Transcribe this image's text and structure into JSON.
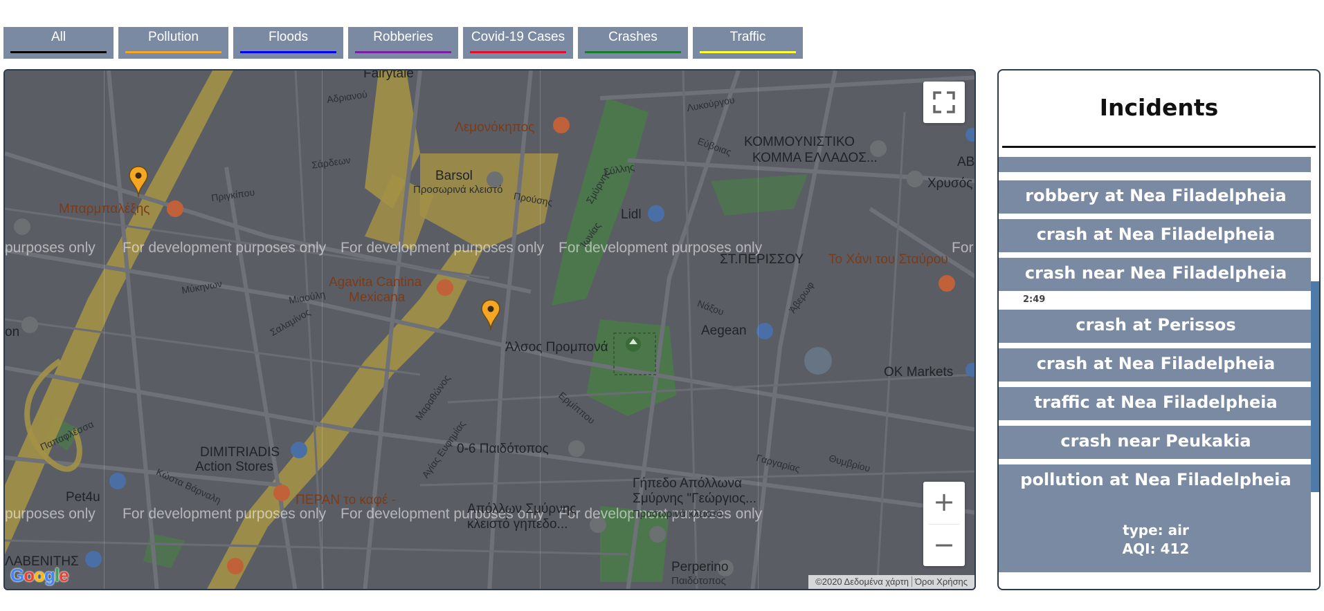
{
  "filters": [
    {
      "label": "All",
      "color": "#000000"
    },
    {
      "label": "Pollution",
      "color": "#f5a623"
    },
    {
      "label": "Floods",
      "color": "#0000ff"
    },
    {
      "label": "Robberies",
      "color": "#7b1fa2"
    },
    {
      "label": "Covid-19 Cases",
      "color": "#e0102a"
    },
    {
      "label": "Crashes",
      "color": "#1b7a2b"
    },
    {
      "label": "Traffic",
      "color": "#ffff33"
    }
  ],
  "map": {
    "watermark": "For development purposes only",
    "watermark_partial": "purposes only",
    "watermark_edge": "For",
    "pois": {
      "fairytale": "Fairytale",
      "lemonokipos": "Λεμονόκηπος",
      "barsol": "Barsol",
      "barsol_sub": "Προσωρινά κλειστό",
      "lidl": "Lidl",
      "kke_1": "ΚΟΜΜΟΥΝΙΣΤΙΚΟ",
      "kke_2": "ΚΟΜΜΑ ΕΛΛΑΔΟΣ...",
      "chrysos": "Χρυσός",
      "ab": "ΑΒ",
      "barbalexis": "Μπαρμπαλέξης",
      "agavita_1": "Agavita Cantina",
      "agavita_2": "Mexicana",
      "st_perissou": "ΣΤ.ΠΕΡΙΣΣΟΥ",
      "to_chani": "Το Χάνι του Σταύρου",
      "aegean": "Aegean",
      "alsos": "Άλσος Προμπονά",
      "ok_markets": "OK Markets",
      "dimitriadis_1": "DIMITRIADIS",
      "dimitriadis_2": "Action Stores",
      "paidotopos": "0-6 Παιδότοπος",
      "gipedo_1": "Γήπεδο Απόλλωνα",
      "gipedo_2": "Σμύρνης \"Γεώργιος...",
      "gipedo_3": "Προσωρινά κλειστό",
      "pet4u": "Pet4u",
      "peran": "ΠΕΡΑΝ το καφέ -",
      "apollon_1": "Απόλλων Σμύρνης",
      "apollon_2": "κλειστό γηπεδο...",
      "lavenitis": "ΛΑΒΕΝΙΤΗΣ",
      "perperino_1": "Perperino",
      "perperino_2": "Παιδότοπος",
      "on": "on"
    },
    "streets": {
      "s1": "Σάρδεων",
      "s2": "Πριγκίπου",
      "s3": "Αδριανού",
      "s4": "Λυκούργου",
      "s5": "Εύβοιας",
      "s6": "Σύλλης",
      "s7": "Προύσης",
      "s8": "Μιαούλη",
      "s9": "Σαλαμίνος",
      "s10": "Μύκηνων",
      "s11": "Νάξου",
      "s12": "Άβερωφ",
      "s13": "Μαραθώνος",
      "s14": "Αγίας Ευφημίας",
      "s15": "Ερμίππου",
      "s16": "Κώστα Βάρναλη",
      "s17": "Παπαφλέσσα",
      "s18": "Σμύρνης",
      "s19": "Ίωνίας",
      "s20": "Γαργαρίας",
      "s21": "Θυμβρίου"
    },
    "fullscreen_icon": "fullscreen-icon",
    "zoom_in": "+",
    "zoom_out": "−",
    "attribution": {
      "data": "©2020 Δεδομένα χάρτη",
      "terms": "Όροι Χρήσης"
    },
    "google_logo": {
      "text": "Google",
      "colors": [
        "#4285F4",
        "#EA4335",
        "#FBBC05",
        "#4285F4",
        "#34A853",
        "#EA4335"
      ]
    }
  },
  "panel": {
    "title": "Incidents",
    "incidents": [
      {
        "title": "robbery at Nea Filadelpheia"
      },
      {
        "title": "crash at Nea Filadelpheia"
      },
      {
        "title": "crash near Nea Filadelpheia"
      },
      {
        "title": "crash at Perissos"
      },
      {
        "title": "crash at Nea Filadelpheia"
      },
      {
        "title": "traffic at Nea Filadelpheia"
      },
      {
        "title": "crash near Peukakia"
      },
      {
        "title": "pollution at Nea Filadelpheia",
        "type": "type: air",
        "aqi": "AQI: 412"
      }
    ],
    "time_label": "2:49",
    "accent": "#7a8aa3",
    "scrollbar_color": "#4d7aa8"
  }
}
